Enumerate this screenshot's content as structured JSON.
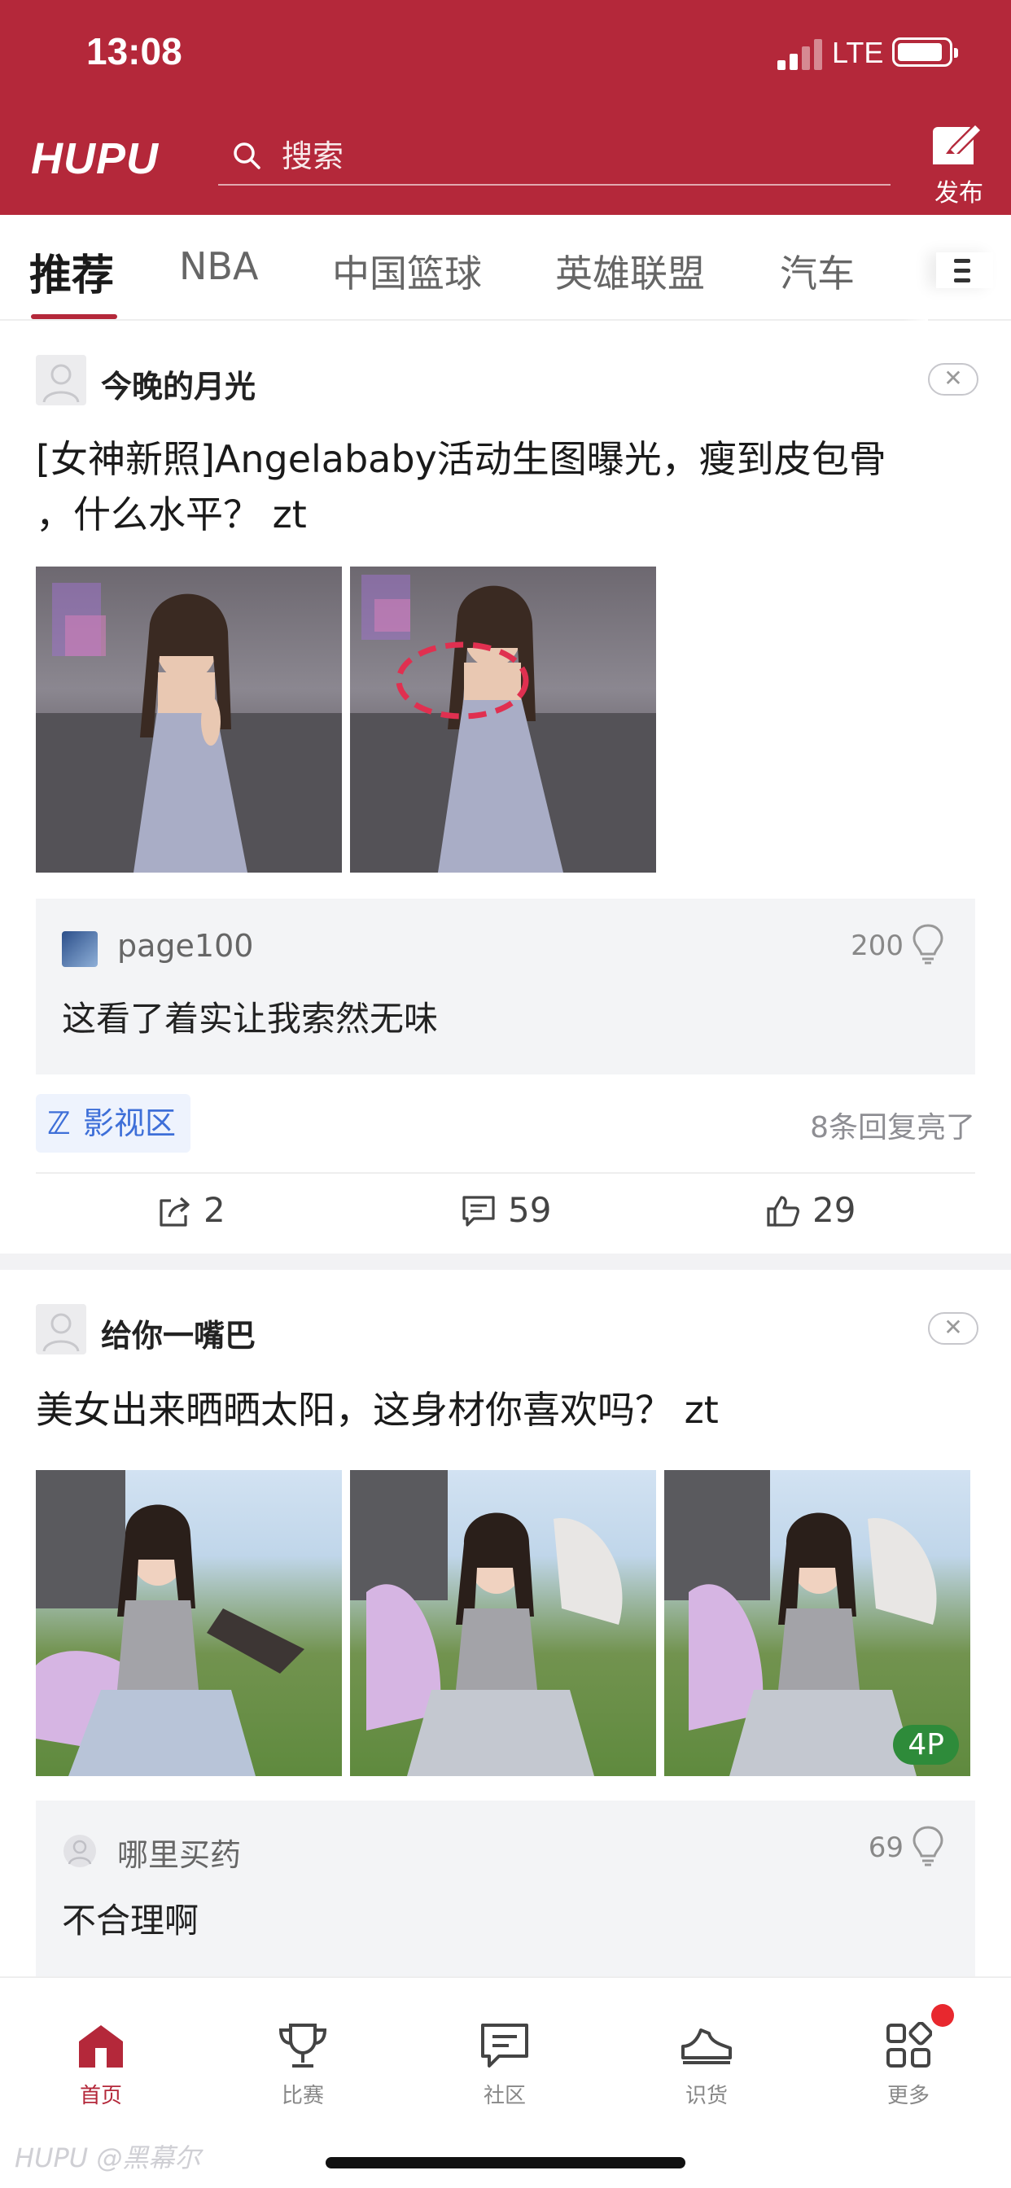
{
  "status_bar": {
    "time": "13:08",
    "network": "LTE"
  },
  "header": {
    "logo": "HUPU",
    "search_placeholder": "搜索",
    "post_label": "发布"
  },
  "tabs": [
    {
      "label": "推荐",
      "active": true
    },
    {
      "label": "NBA"
    },
    {
      "label": "中国篮球"
    },
    {
      "label": "英雄联盟"
    },
    {
      "label": "汽车"
    }
  ],
  "posts": [
    {
      "author": "今晚的月光",
      "title_line1": "[女神新照]Angelababy活动生图曝光，瘦到皮包骨",
      "title_line2": "，什么水平？ zt",
      "image_count": 2,
      "top_comment": {
        "user": "page100",
        "likes": "200",
        "text": "这看了着实让我索然无味"
      },
      "channel": "影视区",
      "replies_lit": "8条回复亮了",
      "shares": "2",
      "comments": "59",
      "likes": "29"
    },
    {
      "author": "给你一嘴巴",
      "title": "美女出来晒晒太阳，这身材你喜欢吗？ zt",
      "image_count": 3,
      "photo_badge": "4P",
      "top_comment": {
        "user": "哪里买药",
        "likes": "69",
        "text": "不合理啊"
      }
    }
  ],
  "bottom_nav": [
    {
      "label": "首页",
      "icon": "home-icon",
      "active": true
    },
    {
      "label": "比赛",
      "icon": "trophy-icon"
    },
    {
      "label": "社区",
      "icon": "community-icon"
    },
    {
      "label": "识货",
      "icon": "sneaker-icon"
    },
    {
      "label": "更多",
      "icon": "grid-icon",
      "has_badge": true
    }
  ],
  "watermark": "HUPU @黑幕尔",
  "colors": {
    "brand_red": "#b4283a",
    "channel_blue": "#3e6fd8",
    "badge_green": "#2e8b3a"
  }
}
